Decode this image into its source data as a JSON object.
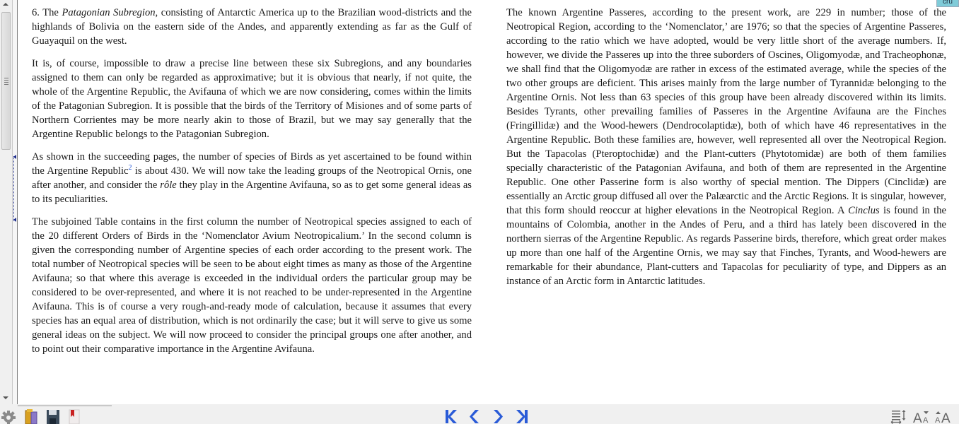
{
  "document": {
    "left_column": {
      "paragraphs": [
        {
          "number": "6. The ",
          "italic": "Patagonian Subregion",
          "text": ", consisting of Antarctic America up to the Brazilian wood-districts and the highlands of Bolivia on the eastern side of the Andes, and apparently extending as far as the Gulf of Guayaquil on the west."
        },
        {
          "text": "It is, of course, impossible to draw a precise line between these six Subregions, and any boundaries assigned to them can only be regarded as approximative; but it is obvious that nearly, if not quite, the whole of the Argentine Republic, the Avifauna of which we are now considering, comes within the limits of the Patagonian Subregion. It is possible that the birds of the Territory of Misiones and of some parts of Northern Corrientes may be more nearly akin to those of Brazil, but we may say generally that the Argentine Republic belongs to the Patagonian Subregion."
        },
        {
          "text_before_note": "As shown in the succeeding pages, the number of species of Birds as yet ascertained to be found within the Argentine Republic",
          "footnote": "2",
          "text_after_note": " is about 430. We will now take the leading groups of the Neotropical Ornis, one after another, and consider the ",
          "italic": "rôle",
          "text_end": " they play in the Argentine Avifauna, so as to get some general ideas as to its peculiarities."
        },
        {
          "text": "The subjoined Table contains in the first column the number of Neotropical species assigned to each of the 20 different Orders of Birds in the ‘Nomenclator Avium Neotropicalium.’ In the second column is given the corresponding number of Argentine species of each order according to the present work. The total number of Neotropical species will be seen to be about eight times as many as those of the Argentine Avifauna; so that where this average is exceeded in the individual orders the particular group may be considered to be over-represented, and where it is not reached to be under-represented in the Argentine Avifauna. This is of course a very rough-and-ready mode of calculation, because it assumes that every species has an equal area of distribution, which is not ordinarily the case; but it will serve to give us some general ideas on the subject. We will now proceed to consider the principal groups one after another, and to point out their comparative importance in the Argentine Avifauna."
        }
      ]
    },
    "right_column": {
      "paragraph": {
        "text_before": "The known Argentine Passeres, according to the present work, are 229 in number; those of the Neotropical Region, according to the ‘Nomenclator,’ are 1976; so that the species of Argentine Passeres, according to the ratio which we have adopted, would be very little short of the average numbers. If, however, we divide the Passeres up into the three suborders of Oscines, Oligomyodæ, and Tracheophonæ, we shall find that the Oligomyodæ are rather in excess of the estimated average, while the species of the two other groups are deficient. This arises mainly from the large number of Tyrannidæ belonging to the Argentine Ornis. Not less than 63 species of this group have been already discovered within its limits. Besides Tyrants, other prevailing families of Passeres in the Argentine Avifauna are the Finches (Fringillidæ) and the Wood-hewers (Dendrocolaptidæ), both of which have 46 representatives in the Argentine Republic. Both these families are, however, well represented all over the Neotropical Region. But the Tapacolas (Pteroptochidæ) and the Plant-cutters (Phytotomidæ) are both of them families specially characteristic of the Patagonian Avifauna, and both of them are represented in the Argentine Republic. One other Passerine form is also worthy of special mention. The Dippers (Cinclidæ) are essentially an Arctic group diffused all over the Palæarctic and the Arctic Regions. It is singular, however, that this form should reoccur at higher elevations in the Neotropical Region. A ",
        "italic": "Cinclus",
        "text_after": " is found in the mountains of Colombia, another in the Andes of Peru, and a third has lately been discovered in the northern sierras of the Argentine Republic. As regards Passerine birds, therefore, which great order makes up more than one half of the Argentine Ornis, we may say that Finches, Tyrants, and Wood-hewers are remarkable for their abundance, Plant-cutters and Tapacolas for peculiarity of type, and Dippers as an instance of an Arctic form in Antarctic latitudes."
      }
    },
    "corner_tab_label": "cru"
  },
  "toolbar": {
    "left_icons": [
      "gear-icon",
      "library-icon",
      "save-icon",
      "bookmark-icon"
    ],
    "nav": [
      "first-page",
      "previous-page",
      "next-page",
      "last-page"
    ],
    "right_icons": [
      "line-spacing-icon",
      "decrease-font-icon",
      "increase-font-icon"
    ],
    "colors": {
      "nav_accent": "#2a5bd7"
    }
  }
}
